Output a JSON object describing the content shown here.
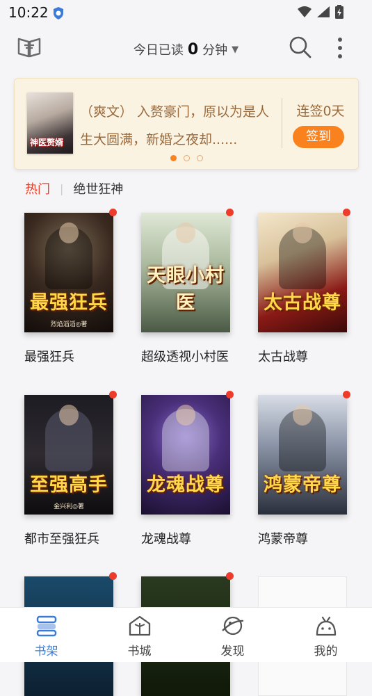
{
  "status_bar": {
    "time": "10:22"
  },
  "header": {
    "read_prefix": "今日已读",
    "read_minutes": "0",
    "read_suffix": "分钟"
  },
  "banner": {
    "cover_title": "神医赘婿",
    "text": "（爽文） 入赘豪门，原以为是人生大圆满，新婚之夜却......",
    "streak": "连签0天",
    "sign_button": "签到",
    "pages": 3,
    "active_page": 1
  },
  "categories": {
    "hot": "热门",
    "separator": "|",
    "tag": "绝世狂神"
  },
  "books": [
    {
      "title": "最强狂兵",
      "cover_text": "最强狂兵",
      "cover_author": "烈焰滔滔◎著"
    },
    {
      "title": "超级透视小村医",
      "cover_text": "天眼小村医",
      "cover_author": ""
    },
    {
      "title": "太古战尊",
      "cover_text": "太古战尊",
      "cover_author": ""
    },
    {
      "title": "都市至强狂兵",
      "cover_text": "至强高手",
      "cover_author": "金兴利◎著"
    },
    {
      "title": "龙魂战尊",
      "cover_text": "龙魂战尊",
      "cover_author": ""
    },
    {
      "title": "鸿蒙帝尊",
      "cover_text": "鸿蒙帝尊",
      "cover_author": ""
    }
  ],
  "bottom_nav": [
    {
      "label": "书架",
      "active": true
    },
    {
      "label": "书城",
      "active": false
    },
    {
      "label": "发现",
      "active": false
    },
    {
      "label": "我的",
      "active": false
    }
  ],
  "colors": {
    "accent": "#3b7bd8",
    "orange": "#f9821e",
    "hot": "#e8412b",
    "badge": "#ee3b2b"
  }
}
